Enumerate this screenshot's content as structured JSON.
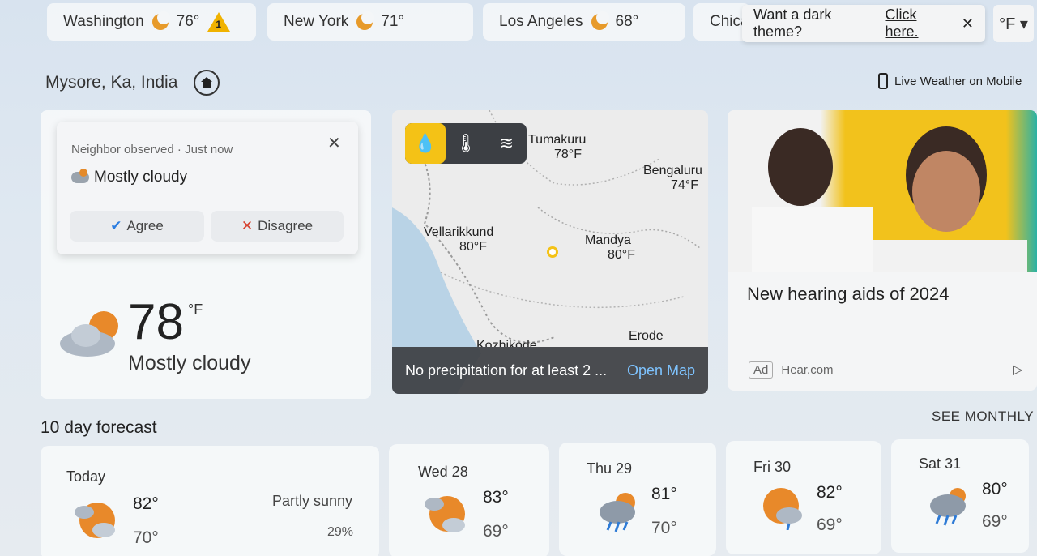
{
  "cities": [
    {
      "name": "Washington",
      "temp": "76°",
      "alert": "1"
    },
    {
      "name": "New York",
      "temp": "71°"
    },
    {
      "name": "Los Angeles",
      "temp": "68°"
    },
    {
      "name": "Chica"
    }
  ],
  "toast": {
    "text": "Want a dark theme?",
    "link": "Click here.",
    "close": "✕"
  },
  "unit_button": "°F ▾",
  "location": {
    "name": "Mysore, Ka, India"
  },
  "mobile_link": "Live Weather on Mobile",
  "popup": {
    "observed": "Neighbor observed · Just now",
    "condition": "Mostly cloudy",
    "agree": "Agree",
    "disagree": "Disagree",
    "close": "✕"
  },
  "current": {
    "temp": "78",
    "unit": "°F",
    "condition": "Mostly cloudy"
  },
  "map": {
    "labels": [
      {
        "name": "Tumakuru",
        "temp": "78°F"
      },
      {
        "name": "Bengaluru",
        "temp": "74°F"
      },
      {
        "name": "Vellarikkund",
        "temp": "80°F"
      },
      {
        "name": "Mandya",
        "temp": "80°F"
      },
      {
        "name": "Erode",
        "temp": ""
      },
      {
        "name": "Kozhikode",
        "temp": ""
      }
    ],
    "footer_text": "No precipitation for at least 2 ...",
    "open_map": "Open Map",
    "toolbar": [
      "droplet-icon",
      "thermometer-icon",
      "wind-icon"
    ]
  },
  "ad": {
    "title": "New hearing aids of 2024",
    "badge": "Ad",
    "source": "Hear.com"
  },
  "forecast": {
    "title": "10 day forecast",
    "see_monthly": "SEE MONTHLY",
    "days": [
      {
        "name": "Today",
        "hi": "82°",
        "lo": "70°",
        "cond": "Partly sunny",
        "precip": "29%"
      },
      {
        "name": "Wed 28",
        "hi": "83°",
        "lo": "69°"
      },
      {
        "name": "Thu 29",
        "hi": "81°",
        "lo": "70°"
      },
      {
        "name": "Fri 30",
        "hi": "82°",
        "lo": "69°"
      },
      {
        "name": "Sat 31",
        "hi": "80°",
        "lo": "69°"
      }
    ]
  }
}
